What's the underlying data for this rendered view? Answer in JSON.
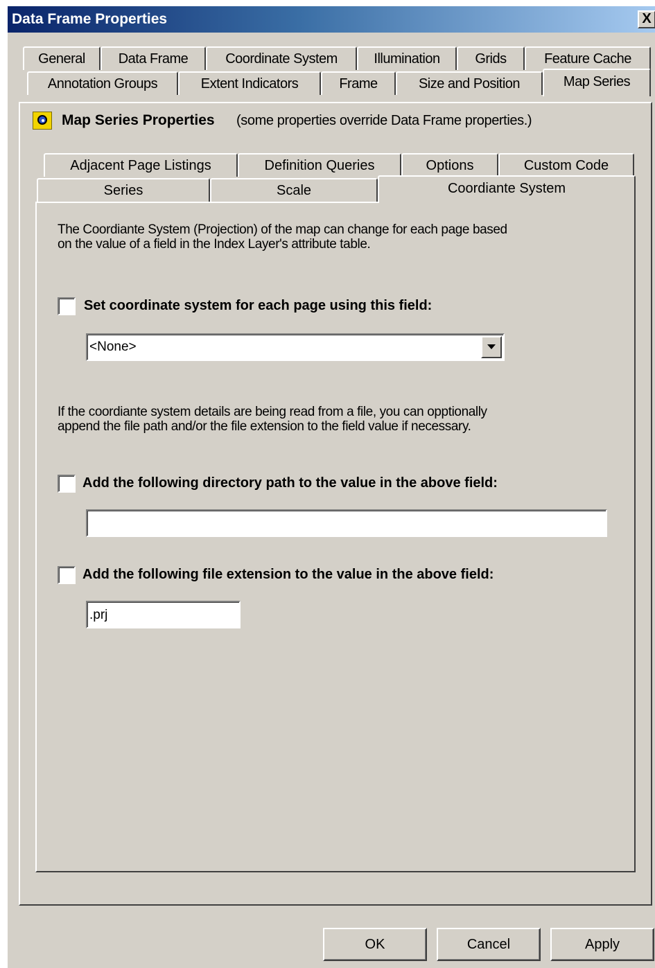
{
  "window": {
    "title": "Data Frame Properties",
    "close_label": "X"
  },
  "outer_tabs": {
    "row1": [
      "General",
      "Data Frame",
      "Coordinate System",
      "Illumination",
      "Grids",
      "Feature Cache"
    ],
    "row2": [
      "Annotation Groups",
      "Extent Indicators",
      "Frame",
      "Size and Position",
      "Map Series"
    ],
    "active": "Map Series"
  },
  "heading": {
    "title": "Map Series Properties",
    "note": "(some properties override Data Frame properties.)",
    "icon": "map-series-icon"
  },
  "inner_tabs": {
    "row1": [
      "Adjacent Page Listings",
      "Definition Queries",
      "Options",
      "Custom Code"
    ],
    "row2": [
      "Series",
      "Scale",
      "Coordiante System"
    ],
    "active": "Coordiante System"
  },
  "content": {
    "intro_line1": "The Coordiante System (Projection) of the map can change for each page based",
    "intro_line2": "on the value of a field in the Index Layer's attribute table.",
    "set_cs_label": "Set coordinate system for each page using this field:",
    "set_cs_checked": false,
    "field_select_value": "<None>",
    "file_note_line1": "If the coordiante system details are being read from a file, you can opptionally",
    "file_note_line2": "append the file path and/or the file extension to the field value if necessary.",
    "dir_path_label": "Add the following directory path to the value in the above field:",
    "dir_path_checked": false,
    "dir_path_value": "",
    "ext_label": "Add the following file extension to the value in the above field:",
    "ext_checked": false,
    "ext_value": ".prj"
  },
  "buttons": {
    "ok": "OK",
    "cancel": "Cancel",
    "apply": "Apply"
  }
}
